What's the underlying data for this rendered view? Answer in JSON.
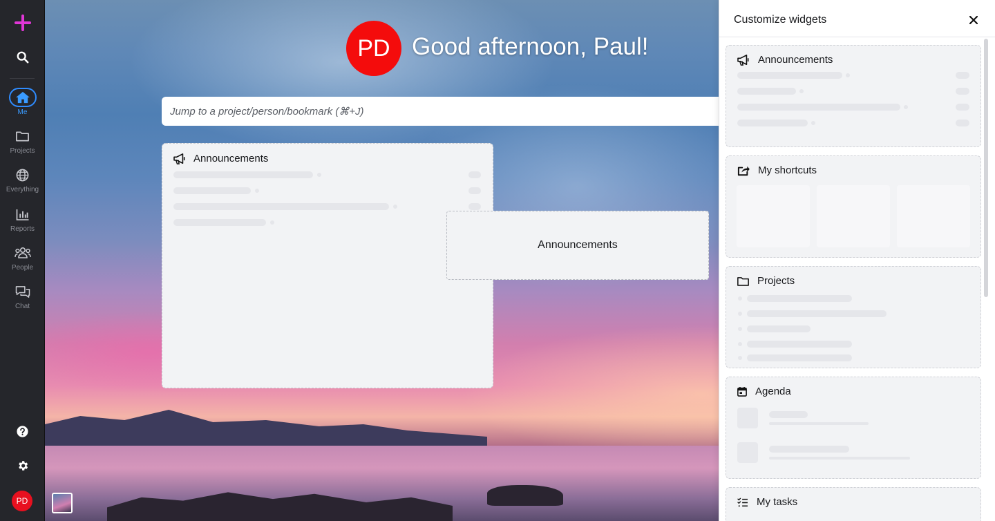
{
  "sidebar": {
    "add_icon": "plus-icon",
    "search_icon": "search-icon",
    "nav": [
      {
        "label": "Me",
        "icon": "home-icon",
        "active": true
      },
      {
        "label": "Projects",
        "icon": "folder-icon"
      },
      {
        "label": "Everything",
        "icon": "globe-icon"
      },
      {
        "label": "Reports",
        "icon": "bar-chart-icon"
      },
      {
        "label": "People",
        "icon": "people-icon"
      },
      {
        "label": "Chat",
        "icon": "chat-icon"
      }
    ],
    "help_icon": "help-icon",
    "settings_icon": "gear-icon",
    "user_initials": "PD",
    "accent": "#3a9bff",
    "add_color": "#e036d6"
  },
  "header": {
    "avatar_initials": "PD",
    "greeting": "Good afternoon, Paul!",
    "avatar_color": "#f40c0c"
  },
  "search": {
    "placeholder": "Jump to a project/person/bookmark (⌘+J)"
  },
  "dashboard": {
    "widget_title": "Announcements",
    "dragging_label": "Announcements"
  },
  "panel": {
    "title": "Customize widgets",
    "widgets": [
      {
        "title": "Announcements",
        "icon": "megaphone-icon"
      },
      {
        "title": "My shortcuts",
        "icon": "share-icon"
      },
      {
        "title": "Projects",
        "icon": "folder-icon"
      },
      {
        "title": "Agenda",
        "icon": "calendar-icon"
      },
      {
        "title": "My tasks",
        "icon": "tasks-icon"
      }
    ]
  }
}
